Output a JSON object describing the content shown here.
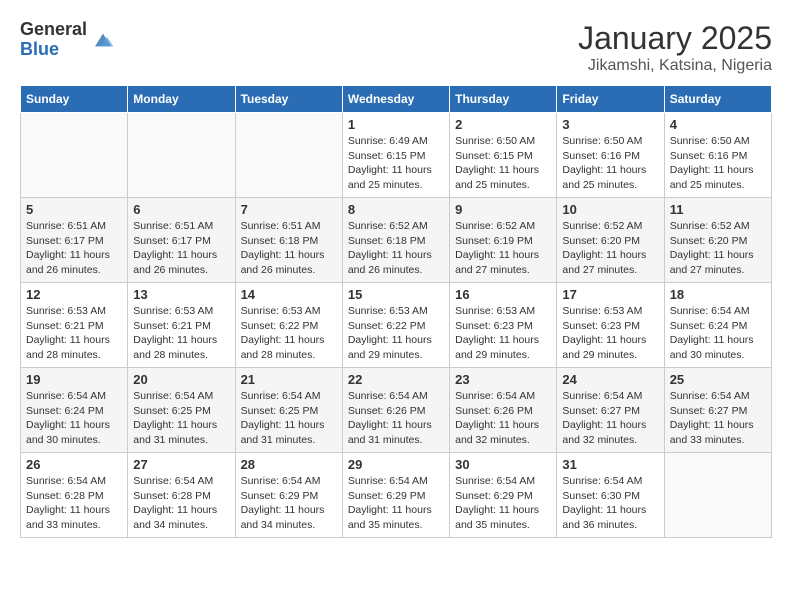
{
  "logo": {
    "general": "General",
    "blue": "Blue"
  },
  "header": {
    "title": "January 2025",
    "subtitle": "Jikamshi, Katsina, Nigeria"
  },
  "weekdays": [
    "Sunday",
    "Monday",
    "Tuesday",
    "Wednesday",
    "Thursday",
    "Friday",
    "Saturday"
  ],
  "weeks": [
    [
      {
        "day": "",
        "info": ""
      },
      {
        "day": "",
        "info": ""
      },
      {
        "day": "",
        "info": ""
      },
      {
        "day": "1",
        "info": "Sunrise: 6:49 AM\nSunset: 6:15 PM\nDaylight: 11 hours and 25 minutes."
      },
      {
        "day": "2",
        "info": "Sunrise: 6:50 AM\nSunset: 6:15 PM\nDaylight: 11 hours and 25 minutes."
      },
      {
        "day": "3",
        "info": "Sunrise: 6:50 AM\nSunset: 6:16 PM\nDaylight: 11 hours and 25 minutes."
      },
      {
        "day": "4",
        "info": "Sunrise: 6:50 AM\nSunset: 6:16 PM\nDaylight: 11 hours and 25 minutes."
      }
    ],
    [
      {
        "day": "5",
        "info": "Sunrise: 6:51 AM\nSunset: 6:17 PM\nDaylight: 11 hours and 26 minutes."
      },
      {
        "day": "6",
        "info": "Sunrise: 6:51 AM\nSunset: 6:17 PM\nDaylight: 11 hours and 26 minutes."
      },
      {
        "day": "7",
        "info": "Sunrise: 6:51 AM\nSunset: 6:18 PM\nDaylight: 11 hours and 26 minutes."
      },
      {
        "day": "8",
        "info": "Sunrise: 6:52 AM\nSunset: 6:18 PM\nDaylight: 11 hours and 26 minutes."
      },
      {
        "day": "9",
        "info": "Sunrise: 6:52 AM\nSunset: 6:19 PM\nDaylight: 11 hours and 27 minutes."
      },
      {
        "day": "10",
        "info": "Sunrise: 6:52 AM\nSunset: 6:20 PM\nDaylight: 11 hours and 27 minutes."
      },
      {
        "day": "11",
        "info": "Sunrise: 6:52 AM\nSunset: 6:20 PM\nDaylight: 11 hours and 27 minutes."
      }
    ],
    [
      {
        "day": "12",
        "info": "Sunrise: 6:53 AM\nSunset: 6:21 PM\nDaylight: 11 hours and 28 minutes."
      },
      {
        "day": "13",
        "info": "Sunrise: 6:53 AM\nSunset: 6:21 PM\nDaylight: 11 hours and 28 minutes."
      },
      {
        "day": "14",
        "info": "Sunrise: 6:53 AM\nSunset: 6:22 PM\nDaylight: 11 hours and 28 minutes."
      },
      {
        "day": "15",
        "info": "Sunrise: 6:53 AM\nSunset: 6:22 PM\nDaylight: 11 hours and 29 minutes."
      },
      {
        "day": "16",
        "info": "Sunrise: 6:53 AM\nSunset: 6:23 PM\nDaylight: 11 hours and 29 minutes."
      },
      {
        "day": "17",
        "info": "Sunrise: 6:53 AM\nSunset: 6:23 PM\nDaylight: 11 hours and 29 minutes."
      },
      {
        "day": "18",
        "info": "Sunrise: 6:54 AM\nSunset: 6:24 PM\nDaylight: 11 hours and 30 minutes."
      }
    ],
    [
      {
        "day": "19",
        "info": "Sunrise: 6:54 AM\nSunset: 6:24 PM\nDaylight: 11 hours and 30 minutes."
      },
      {
        "day": "20",
        "info": "Sunrise: 6:54 AM\nSunset: 6:25 PM\nDaylight: 11 hours and 31 minutes."
      },
      {
        "day": "21",
        "info": "Sunrise: 6:54 AM\nSunset: 6:25 PM\nDaylight: 11 hours and 31 minutes."
      },
      {
        "day": "22",
        "info": "Sunrise: 6:54 AM\nSunset: 6:26 PM\nDaylight: 11 hours and 31 minutes."
      },
      {
        "day": "23",
        "info": "Sunrise: 6:54 AM\nSunset: 6:26 PM\nDaylight: 11 hours and 32 minutes."
      },
      {
        "day": "24",
        "info": "Sunrise: 6:54 AM\nSunset: 6:27 PM\nDaylight: 11 hours and 32 minutes."
      },
      {
        "day": "25",
        "info": "Sunrise: 6:54 AM\nSunset: 6:27 PM\nDaylight: 11 hours and 33 minutes."
      }
    ],
    [
      {
        "day": "26",
        "info": "Sunrise: 6:54 AM\nSunset: 6:28 PM\nDaylight: 11 hours and 33 minutes."
      },
      {
        "day": "27",
        "info": "Sunrise: 6:54 AM\nSunset: 6:28 PM\nDaylight: 11 hours and 34 minutes."
      },
      {
        "day": "28",
        "info": "Sunrise: 6:54 AM\nSunset: 6:29 PM\nDaylight: 11 hours and 34 minutes."
      },
      {
        "day": "29",
        "info": "Sunrise: 6:54 AM\nSunset: 6:29 PM\nDaylight: 11 hours and 35 minutes."
      },
      {
        "day": "30",
        "info": "Sunrise: 6:54 AM\nSunset: 6:29 PM\nDaylight: 11 hours and 35 minutes."
      },
      {
        "day": "31",
        "info": "Sunrise: 6:54 AM\nSunset: 6:30 PM\nDaylight: 11 hours and 36 minutes."
      },
      {
        "day": "",
        "info": ""
      }
    ]
  ]
}
